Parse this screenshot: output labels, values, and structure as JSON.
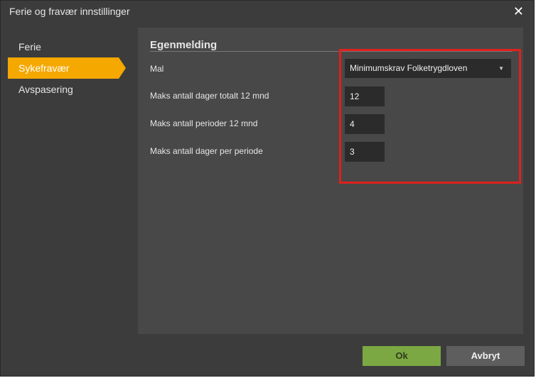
{
  "window": {
    "title": "Ferie og fravær innstillinger",
    "close_glyph": "✕"
  },
  "sidebar": {
    "items": [
      {
        "label": "Ferie",
        "active": false
      },
      {
        "label": "Sykefravær",
        "active": true
      },
      {
        "label": "Avspasering",
        "active": false
      }
    ]
  },
  "main": {
    "section_title": "Egenmelding",
    "fields": {
      "mal": {
        "label": "Mal",
        "value": "Minimumskrav Folketrygdloven"
      },
      "max_days_total": {
        "label": "Maks antall dager totalt 12 mnd",
        "value": "12"
      },
      "max_periods": {
        "label": "Maks antall perioder 12 mnd",
        "value": "4"
      },
      "max_days_period": {
        "label": "Maks antall dager per periode",
        "value": "3"
      }
    },
    "highlight_color": "#e0201c"
  },
  "footer": {
    "ok_label": "Ok",
    "cancel_label": "Avbryt"
  },
  "colors": {
    "accent": "#f5a800",
    "ok_button": "#7ca843",
    "panel": "#484848",
    "background": "#3c3c3c"
  }
}
